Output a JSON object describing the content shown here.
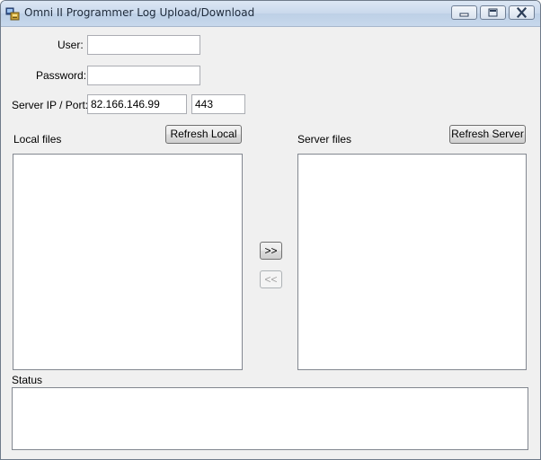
{
  "window": {
    "title": "Omni II Programmer Log Upload/Download"
  },
  "form": {
    "user_label": "User:",
    "user_value": "",
    "password_label": "Password:",
    "password_value": "",
    "server_label": "Server IP / Port:",
    "server_ip": "82.166.146.99",
    "server_port": "443"
  },
  "local": {
    "label": "Local files",
    "refresh_label": "Refresh Local",
    "items": []
  },
  "server": {
    "label": "Server files",
    "refresh_label": "Refresh Server",
    "items": []
  },
  "transfer": {
    "upload_label": ">>",
    "download_label": "<<"
  },
  "status": {
    "label": "Status",
    "text": ""
  }
}
